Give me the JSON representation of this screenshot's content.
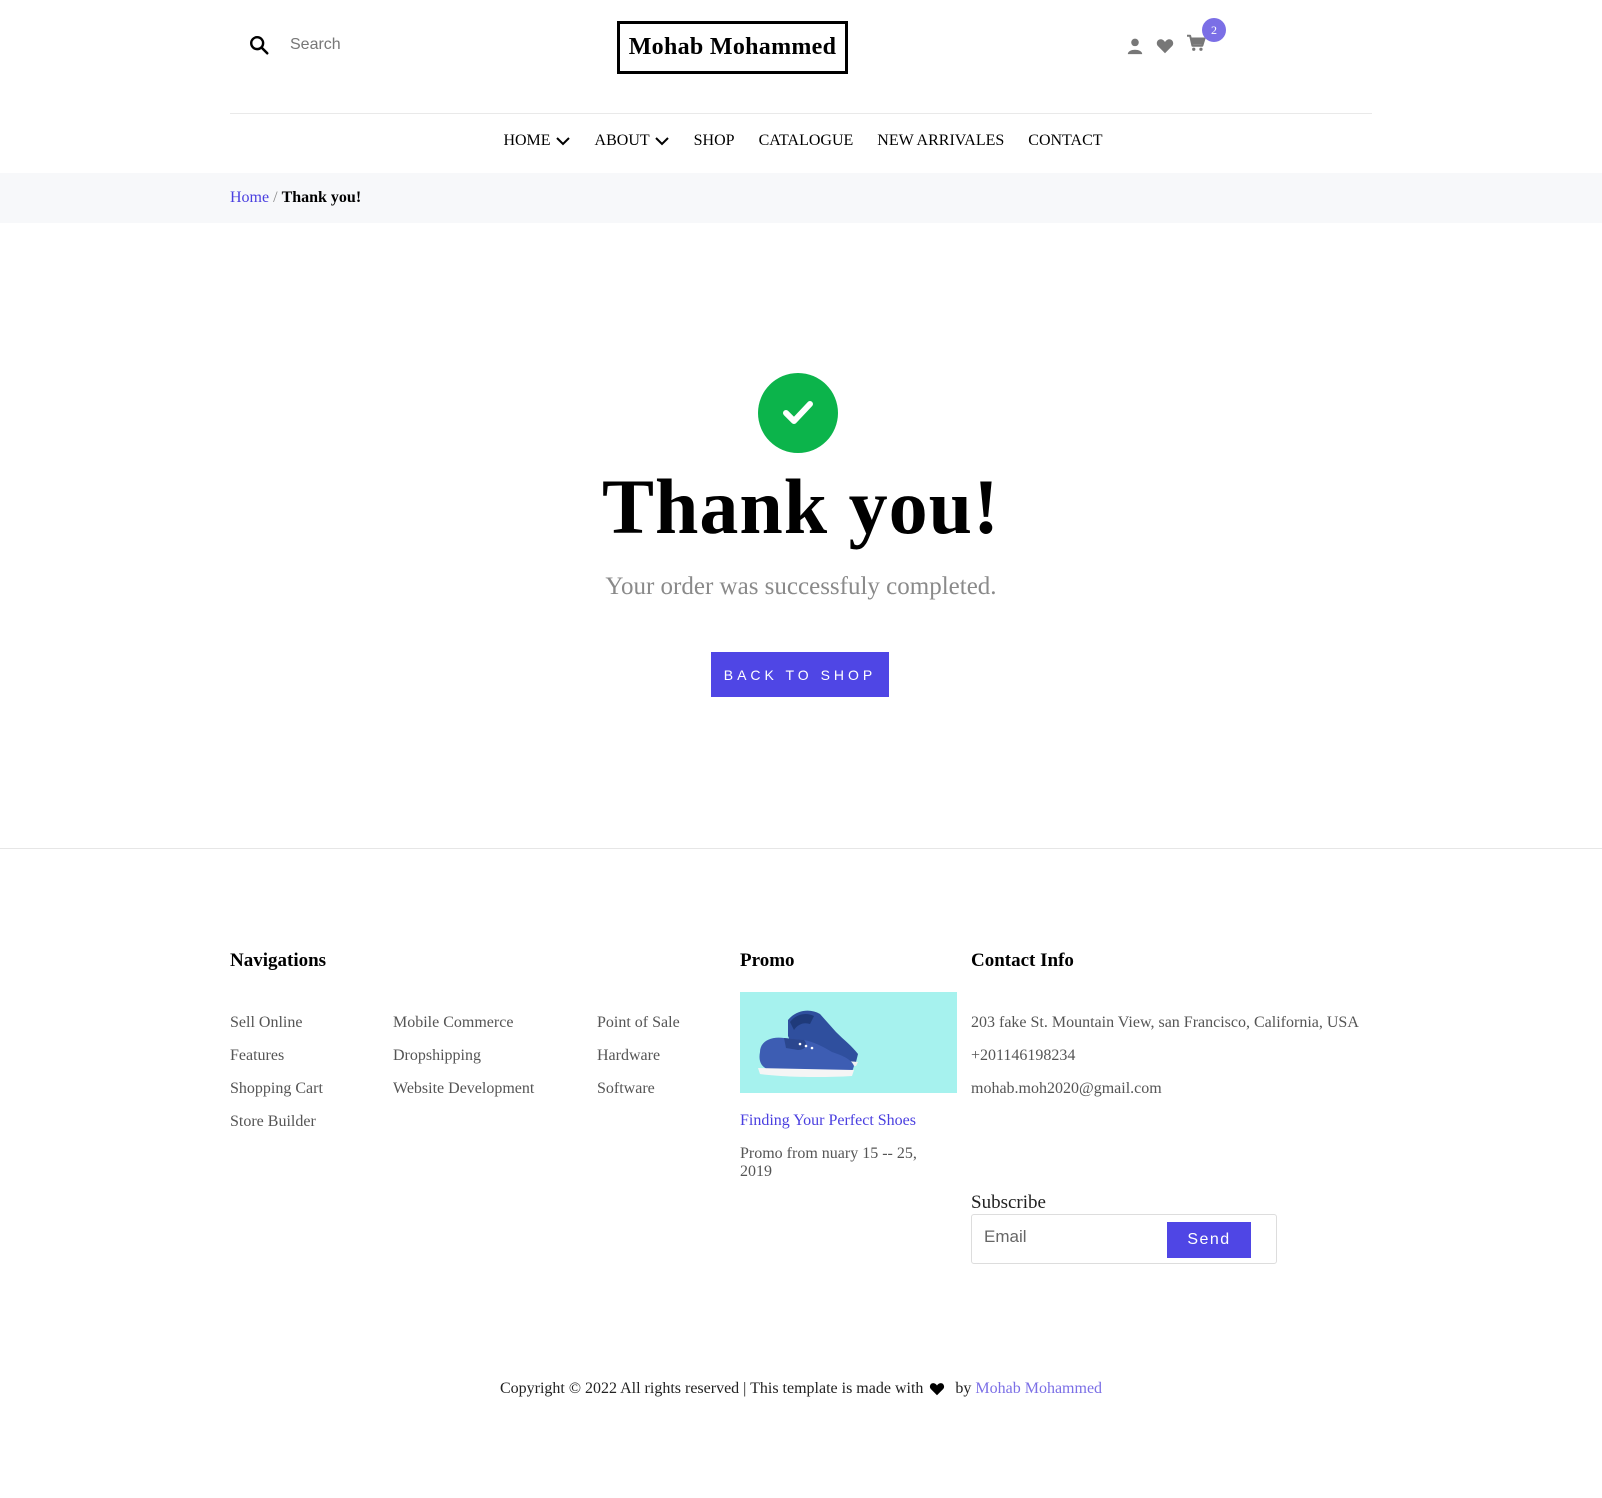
{
  "header": {
    "search_placeholder": "Search",
    "logo_text": "Mohab Mohammed",
    "cart_count": "2",
    "icons": [
      "search-icon",
      "user-icon",
      "heart-icon",
      "cart-icon"
    ]
  },
  "nav": {
    "items": [
      {
        "label": "HOME",
        "dropdown": true
      },
      {
        "label": "ABOUT",
        "dropdown": true
      },
      {
        "label": "SHOP",
        "dropdown": false
      },
      {
        "label": "CATALOGUE",
        "dropdown": false
      },
      {
        "label": "NEW ARRIVALES",
        "dropdown": false
      },
      {
        "label": "CONTACT",
        "dropdown": false
      }
    ]
  },
  "breadcrumb": {
    "home": "Home",
    "separator": "/",
    "current": "Thank you!"
  },
  "main": {
    "title": "Thank you!",
    "subtitle": "Your order was successfuly completed.",
    "button_label": "BACK TO SHOP",
    "success_color": "#0cb44b"
  },
  "footer": {
    "navigations_title": "Navigations",
    "nav_col1": [
      "Sell Online",
      "Features",
      "Shopping Cart",
      "Store Builder"
    ],
    "nav_col2": [
      "Mobile Commerce",
      "Dropshipping",
      "Website Development"
    ],
    "nav_col3": [
      "Point of Sale",
      "Hardware",
      "Software"
    ],
    "promo_title": "Promo",
    "promo_link": "Finding Your Perfect Shoes",
    "promo_text": "Promo from nuary 15 -- 25, 2019",
    "contact_title": "Contact Info",
    "contact": {
      "address": "203 fake St. Mountain View, san Francisco, California, USA",
      "phone": "+201146198234",
      "email": "mohab.moh2020@gmail.com"
    },
    "subscribe_label": "Subscribe",
    "email_placeholder": "Email",
    "send_label": "Send",
    "copyright_prefix": "Copyright © 2022 All rights reserved | This template is made with",
    "copyright_by": "by",
    "copyright_author": "Mohab Mohammed"
  },
  "colors": {
    "accent": "#4f46e5",
    "badge": "#7b6fe6",
    "promo_bg": "#a6f2ee",
    "breadcrumb_bg": "#f7f8fa"
  }
}
